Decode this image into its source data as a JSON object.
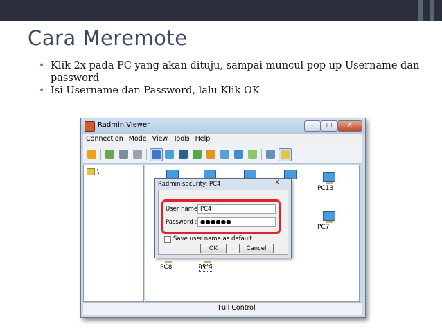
{
  "slide": {
    "title": "Cara Meremote",
    "bullets": [
      "Klik 2x pada PC yang akan dituju, sampai muncul pop up Username dan password",
      "Isi Username dan Password, lalu Klik OK"
    ]
  },
  "app": {
    "title": "Radmin Viewer",
    "window_buttons": {
      "minimize": "–",
      "maximize": "□",
      "close": "X"
    },
    "menu": [
      "Connection",
      "Mode",
      "View",
      "Tools",
      "Help"
    ],
    "toolbar_icons": [
      "connect-icon",
      "add-computer-icon",
      "computer-icon",
      "delete-computer-icon",
      "full-control-icon",
      "view-only-icon",
      "telnet-icon",
      "file-transfer-icon",
      "shutdown-icon",
      "chat-icon",
      "voice-chat-icon",
      "message-icon",
      "large-icons-icon",
      "list-view-icon"
    ],
    "tree_root": "\\",
    "computers": [
      "PC13",
      "PC7",
      "PC8",
      "PC9"
    ],
    "status": "Full Control"
  },
  "dialog": {
    "title": "Radmin security: PC4",
    "close": "X",
    "username_label": "User name :",
    "username_value": "PC4",
    "password_label": "Password :",
    "password_value": "●●●●●●",
    "save_label": "Save user name as default",
    "ok_label": "OK",
    "cancel_label": "Cancel"
  }
}
